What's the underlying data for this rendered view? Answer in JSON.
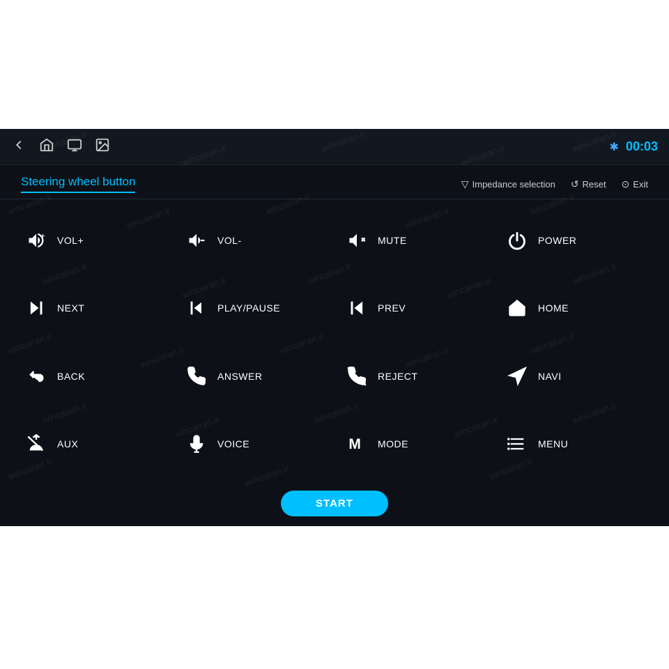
{
  "app": {
    "top_white_height": 185,
    "bottom_white_height": 205
  },
  "topbar": {
    "clock": "00:03",
    "bluetooth_symbol": "✱",
    "icons": [
      "back-icon",
      "home-icon",
      "screen-icon",
      "gallery-icon"
    ]
  },
  "page": {
    "title": "Steering wheel button",
    "actions": [
      {
        "icon": "▽",
        "label": "Impedance selection"
      },
      {
        "icon": "↺",
        "label": "Reset"
      },
      {
        "icon": "⊙",
        "label": "Exit"
      }
    ]
  },
  "buttons": [
    {
      "id": "vol-plus",
      "label": "VOL+",
      "icon": "vol-up"
    },
    {
      "id": "vol-minus",
      "label": "VOL-",
      "icon": "vol-down"
    },
    {
      "id": "mute",
      "label": "MUTE",
      "icon": "mute"
    },
    {
      "id": "power",
      "label": "POWER",
      "icon": "power"
    },
    {
      "id": "next",
      "label": "NEXT",
      "icon": "next"
    },
    {
      "id": "play-pause",
      "label": "PLAY/PAUSE",
      "icon": "play-pause"
    },
    {
      "id": "prev",
      "label": "PREV",
      "icon": "prev"
    },
    {
      "id": "home",
      "label": "HOME",
      "icon": "home"
    },
    {
      "id": "back",
      "label": "BACK",
      "icon": "back"
    },
    {
      "id": "answer",
      "label": "ANSWER",
      "icon": "answer"
    },
    {
      "id": "reject",
      "label": "REJECT",
      "icon": "reject"
    },
    {
      "id": "navi",
      "label": "NAVI",
      "icon": "navi"
    },
    {
      "id": "aux",
      "label": "AUX",
      "icon": "aux"
    },
    {
      "id": "voice",
      "label": "VOICE",
      "icon": "voice"
    },
    {
      "id": "mode",
      "label": "MODE",
      "icon": "mode"
    },
    {
      "id": "menu",
      "label": "MENU",
      "icon": "menu"
    }
  ],
  "start_button": "START",
  "watermark": "wincairan.ir"
}
